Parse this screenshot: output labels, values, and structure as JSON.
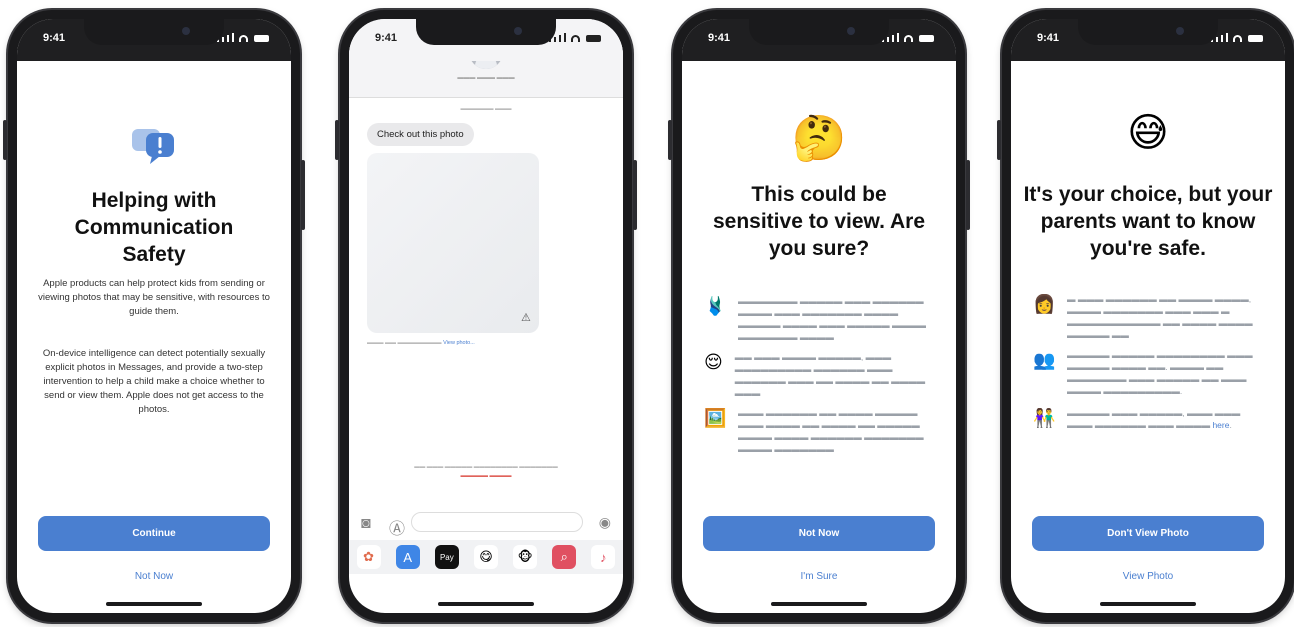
{
  "status": {
    "time": "9:41"
  },
  "screen1": {
    "title": "Helping with Communication Safety",
    "para1": "Apple products can help protect kids from sending or viewing photos that may be sensitive, with resources to guide them.",
    "para2": "On-device intelligence can detect potentially sexually explicit photos in Messages, and provide a two-step intervention to help a child make a choice whether to send or view them. Apple does not get access to the photos.",
    "primary": "Continue",
    "secondary": "Not Now",
    "icon": "chat-bubble-alert-icon"
  },
  "screen2": {
    "bubble": "Check out this photo",
    "caption_link": "View photo..."
  },
  "screen3": {
    "title": "This could be sensitive to view. Are you sure?",
    "emoji": "🤔",
    "primary": "Not Now",
    "secondary": "I'm Sure"
  },
  "screen4": {
    "title": "It's your choice, but your parents want to know you're safe.",
    "link_word": "here",
    "primary": "Don't View Photo",
    "secondary": "View Photo"
  },
  "colors": {
    "accent": "#4a7fd0",
    "bubble": "#e9e9eb"
  }
}
